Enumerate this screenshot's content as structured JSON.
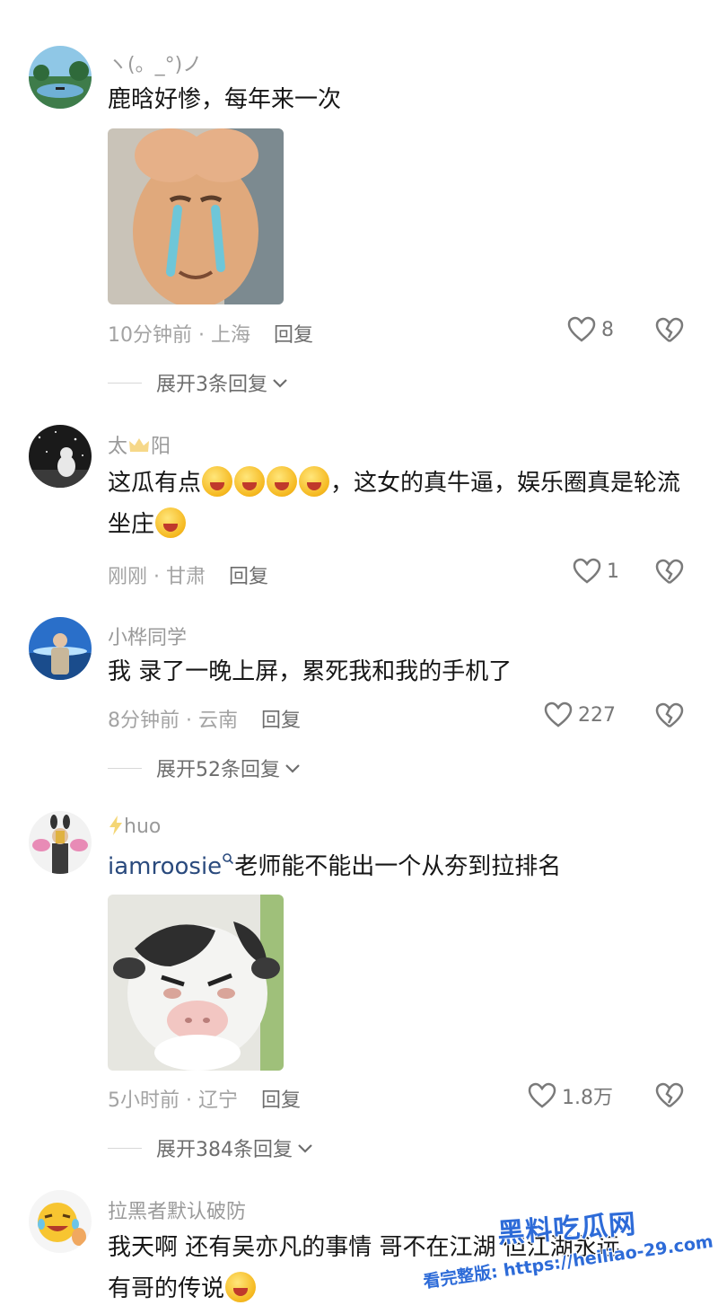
{
  "comments": [
    {
      "username": "ヽ(。_°)ノ",
      "text": "鹿晗好惨，每年来一次",
      "time": "10分钟前 · 上海",
      "reply": "回复",
      "likes": "8",
      "expand": "展开3条回复",
      "sticker": "crying-meme-face"
    },
    {
      "username_pre": "太",
      "username_post": "阳",
      "username_icon": "crown-icon",
      "text_a": "这瓜有点",
      "text_b": "，这女的真牛逼，娱乐圈真是轮流坐庄",
      "emoji": "laugh-cry-emoji",
      "time": "刚刚 · 甘肃",
      "reply": "回复",
      "likes": "1"
    },
    {
      "username": "小桦同学",
      "text": "我 录了一晚上屏，累死我和我的手机了",
      "time": "8分钟前 · 云南",
      "reply": "回复",
      "likes": "227",
      "expand": "展开52条回复"
    },
    {
      "username": "huo",
      "username_icon": "lightning-icon",
      "mention": "iamroosie",
      "mention_icon": "search-icon",
      "text": "老师能不能出一个从夯到拉排名",
      "time": "5小时前 · 辽宁",
      "reply": "回复",
      "likes": "1.8万",
      "expand": "展开384条回复",
      "sticker": "grumpy-cow-sticker"
    },
    {
      "username": "拉黑者默认破防",
      "text_a": "我天啊 还有吴亦凡的事情 哥不在江湖 但江湖永远",
      "text_b": "有哥的传说",
      "emoji": "laugh-cry-emoji"
    }
  ],
  "watermark": {
    "title": "黑料吃瓜网",
    "subtitle": "看完整版: https://heiliao-29.com"
  },
  "colors": {
    "meta": "#a3a3a3",
    "mention": "#2a4a7d",
    "watermark": "#2d6bd8"
  }
}
